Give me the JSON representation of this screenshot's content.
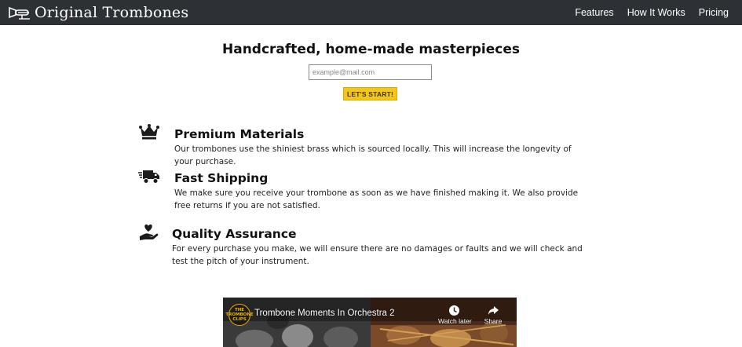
{
  "header": {
    "brand": "Original Trombones",
    "logo_icon": "trombone-logo-icon",
    "nav": [
      {
        "label": "Features"
      },
      {
        "label": "How It Works"
      },
      {
        "label": "Pricing"
      }
    ]
  },
  "hero": {
    "title": "Handcrafted, home-made masterpieces",
    "email_placeholder": "example@mail.com",
    "email_value": "",
    "button_label": "LET'S START!"
  },
  "features": [
    {
      "icon": "crown-icon",
      "title": "Premium Materials",
      "text": "Our trombones use the shiniest brass which is sourced locally. This will increase the longevity of your purchase."
    },
    {
      "icon": "truck-icon",
      "title": "Fast Shipping",
      "text": "We make sure you receive your trombone as soon as we have finished making it. We also provide free returns if you are not satisfied."
    },
    {
      "icon": "hand-heart-icon",
      "title": "Quality Assurance",
      "text": "For every purchase you make, we will ensure there are no damages or faults and we will check and test the pitch of your instrument."
    }
  ],
  "video": {
    "title": "Trombone Moments In Orchestra 2",
    "channel_badge": "THE TROMBONE CLIPS",
    "watch_later": "Watch later",
    "share": "Share"
  },
  "colors": {
    "header_bg": "#2d3035",
    "button_bg": "#f5c518"
  }
}
